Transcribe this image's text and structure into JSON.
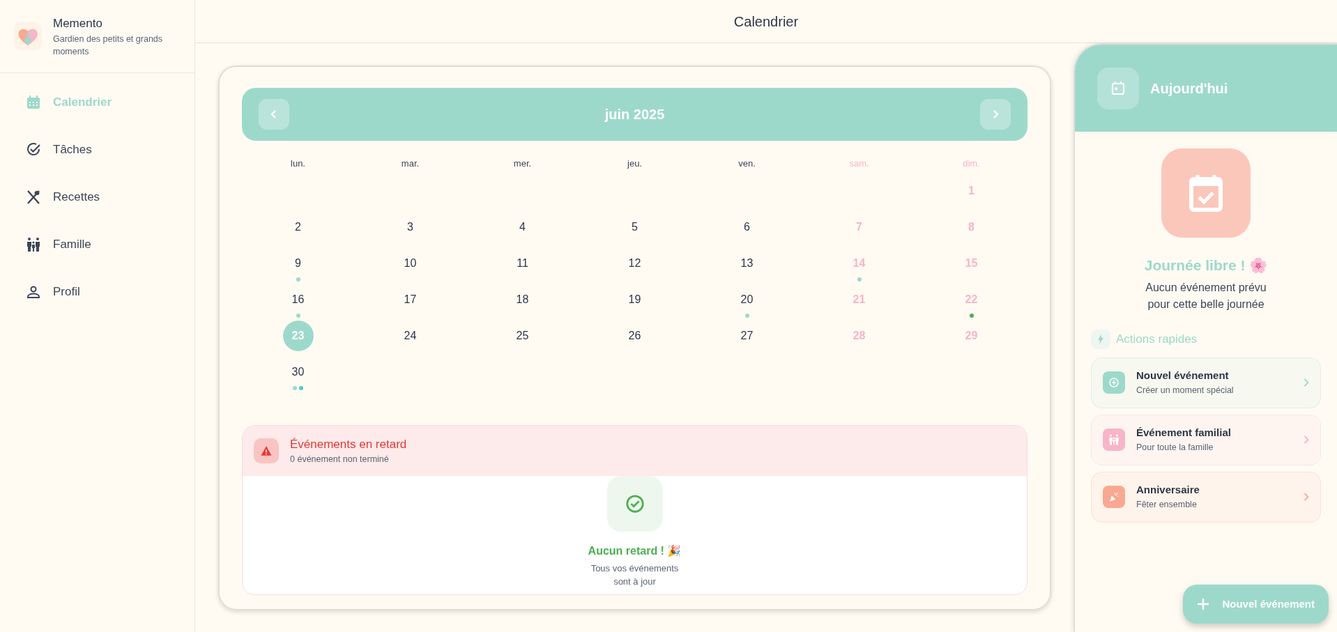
{
  "app": {
    "name": "Memento",
    "tagline": "Gardien des petits et grands moments"
  },
  "sidebar": {
    "items": [
      {
        "kind": "calendar",
        "label": "Calendrier",
        "selected": true
      },
      {
        "kind": "check",
        "label": "Tâches",
        "selected": false
      },
      {
        "kind": "utensils",
        "label": "Recettes",
        "selected": false
      },
      {
        "kind": "family",
        "label": "Famille",
        "selected": false
      },
      {
        "kind": "person",
        "label": "Profil",
        "selected": false
      }
    ]
  },
  "header": {
    "title": "Calendrier"
  },
  "calendar": {
    "month": "juin 2025",
    "weekdays": [
      {
        "label": "lun.",
        "weekend": false
      },
      {
        "label": "mar.",
        "weekend": false
      },
      {
        "label": "mer.",
        "weekend": false
      },
      {
        "label": "jeu.",
        "weekend": false
      },
      {
        "label": "ven.",
        "weekend": false
      },
      {
        "label": "sam.",
        "weekend": true
      },
      {
        "label": "dim.",
        "weekend": true
      }
    ],
    "weeks": [
      [
        {
          "kind": "blank"
        },
        {
          "kind": "blank"
        },
        {
          "kind": "blank"
        },
        {
          "kind": "blank"
        },
        {
          "kind": "blank"
        },
        {
          "kind": "blank"
        },
        {
          "kind": "day",
          "day": "1",
          "selected": false
        }
      ],
      [
        {
          "kind": "day",
          "day": "2",
          "selected": false
        },
        {
          "kind": "day",
          "day": "3",
          "selected": false
        },
        {
          "kind": "day",
          "day": "4",
          "selected": false
        },
        {
          "kind": "day",
          "day": "5",
          "selected": false
        },
        {
          "kind": "day",
          "day": "6",
          "selected": false
        },
        {
          "kind": "day",
          "day": "7",
          "selected": false
        },
        {
          "kind": "day",
          "day": "8",
          "selected": false
        }
      ],
      [
        {
          "kind": "day",
          "day": "9",
          "selected": false,
          "dots": [
            {
              "color": "#9dd9cb"
            }
          ]
        },
        {
          "kind": "day",
          "day": "10",
          "selected": false
        },
        {
          "kind": "day",
          "day": "11",
          "selected": false
        },
        {
          "kind": "day",
          "day": "12",
          "selected": false
        },
        {
          "kind": "day",
          "day": "13",
          "selected": false
        },
        {
          "kind": "day",
          "day": "14",
          "selected": false,
          "dots": [
            {
              "color": "#9dd9cb"
            }
          ]
        },
        {
          "kind": "day",
          "day": "15",
          "selected": false
        }
      ],
      [
        {
          "kind": "day",
          "day": "16",
          "selected": false,
          "dots": [
            {
              "color": "#9dd9cb"
            }
          ]
        },
        {
          "kind": "day",
          "day": "17",
          "selected": false
        },
        {
          "kind": "day",
          "day": "18",
          "selected": false
        },
        {
          "kind": "day",
          "day": "19",
          "selected": false
        },
        {
          "kind": "day",
          "day": "20",
          "selected": false,
          "dots": [
            {
              "color": "#9dd9cb"
            }
          ]
        },
        {
          "kind": "day",
          "day": "21",
          "selected": false
        },
        {
          "kind": "day",
          "day": "22",
          "selected": false,
          "dots": [
            {
              "color": "#4caf50"
            }
          ]
        }
      ],
      [
        {
          "kind": "day",
          "day": "23",
          "selected": true
        },
        {
          "kind": "day",
          "day": "24",
          "selected": false
        },
        {
          "kind": "day",
          "day": "25",
          "selected": false
        },
        {
          "kind": "day",
          "day": "26",
          "selected": false
        },
        {
          "kind": "day",
          "day": "27",
          "selected": false
        },
        {
          "kind": "day",
          "day": "28",
          "selected": false
        },
        {
          "kind": "day",
          "day": "29",
          "selected": false
        }
      ],
      [
        {
          "kind": "day",
          "day": "30",
          "selected": false,
          "dots": [
            {
              "color": "#9dd9cb"
            },
            {
              "color": "#4ecdc4"
            }
          ]
        },
        {
          "kind": "blank"
        },
        {
          "kind": "blank"
        },
        {
          "kind": "blank"
        },
        {
          "kind": "blank"
        },
        {
          "kind": "blank"
        },
        {
          "kind": "blank"
        }
      ]
    ]
  },
  "overdue": {
    "title": "Événements en retard",
    "count": "0 événement non terminé",
    "empty_title": "Aucun retard ! 🎉",
    "empty_text": "Tous vos événements sont à jour"
  },
  "today": {
    "title": "Aujourd'hui",
    "empty_title": "Journée libre ! 🌸",
    "empty_text": "Aucun événement prévu pour cette belle journée",
    "actions_title": "Actions rapides",
    "actions": [
      {
        "kind": "new",
        "title": "Nouvel événement",
        "subtitle": "Créer un moment spécial",
        "color": "#9dd9cb"
      },
      {
        "kind": "family",
        "title": "Événement familial",
        "subtitle": "Pour toute la famille",
        "color": "#f8b4c8"
      },
      {
        "kind": "birthday",
        "title": "Anniversaire",
        "subtitle": "Fêter ensemble",
        "color": "#f9a891"
      }
    ]
  },
  "fab": {
    "label": "Nouvel événement"
  }
}
